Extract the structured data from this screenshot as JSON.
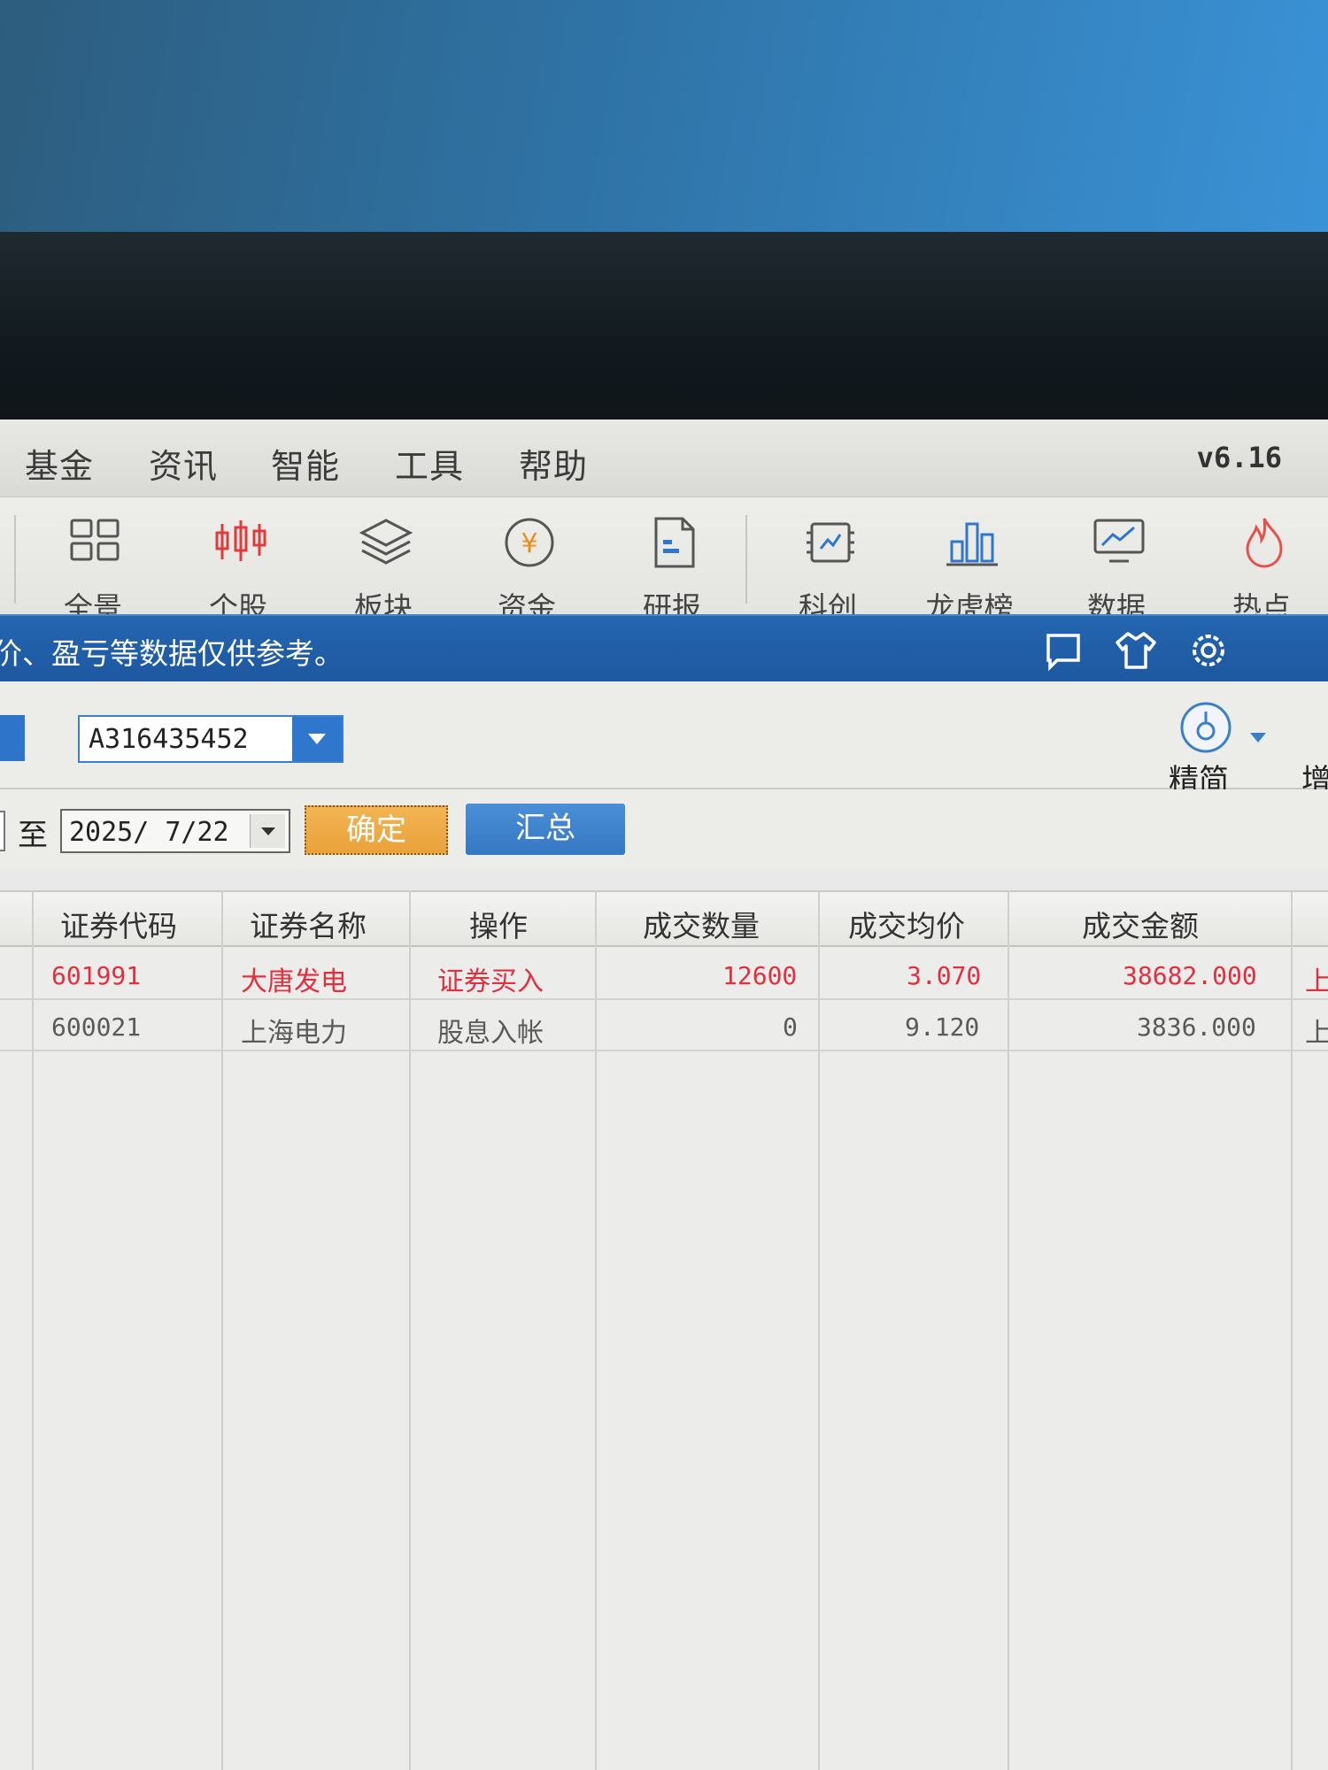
{
  "menu": {
    "items": [
      "基金",
      "资讯",
      "智能",
      "工具",
      "帮助"
    ],
    "version": "v6.16"
  },
  "toolbar": {
    "items": [
      {
        "label": "全景",
        "icon": "grid-icon"
      },
      {
        "label": "个股",
        "icon": "candlestick-icon"
      },
      {
        "label": "板块",
        "icon": "layers-icon"
      },
      {
        "label": "资金",
        "icon": "yuan-icon"
      },
      {
        "label": "研报",
        "icon": "report-icon"
      },
      {
        "label": "科创",
        "icon": "chip-icon"
      },
      {
        "label": "龙虎榜",
        "icon": "bar-chart-icon"
      },
      {
        "label": "数据",
        "icon": "monitor-chart-icon"
      },
      {
        "label": "热点",
        "icon": "flame-icon"
      }
    ]
  },
  "infobar": {
    "notice": "价、盈亏等数据仅供参考。",
    "icons": [
      "message-icon",
      "skin-icon",
      "settings-icon"
    ]
  },
  "account": {
    "account_value": "A316435452",
    "simple_label": "精简",
    "add_label": "增"
  },
  "date_filter": {
    "to_label": "至",
    "end_date": "2025/ 7/22",
    "confirm_label": "确定",
    "summary_label": "汇总"
  },
  "table": {
    "columns": [
      "证券代码",
      "证券名称",
      "操作",
      "成交数量",
      "成交均价",
      "成交金额"
    ],
    "rows": [
      {
        "code": "601991",
        "name": "大唐发电",
        "action": "证券买入",
        "qty": "12600",
        "avg_price": "3.070",
        "amount": "38682.000",
        "extra": "上",
        "color": "#e03040"
      },
      {
        "code": "600021",
        "name": "上海电力",
        "action": "股息入帐",
        "qty": "0",
        "avg_price": "9.120",
        "amount": "3836.000",
        "extra": "上",
        "color": "#5a5a5a"
      }
    ]
  },
  "colors": {
    "infobar_blue": "#1f5ca6",
    "confirm_orange": "#eea843",
    "summary_blue": "#3e81cc",
    "buy_red": "#e03040"
  }
}
